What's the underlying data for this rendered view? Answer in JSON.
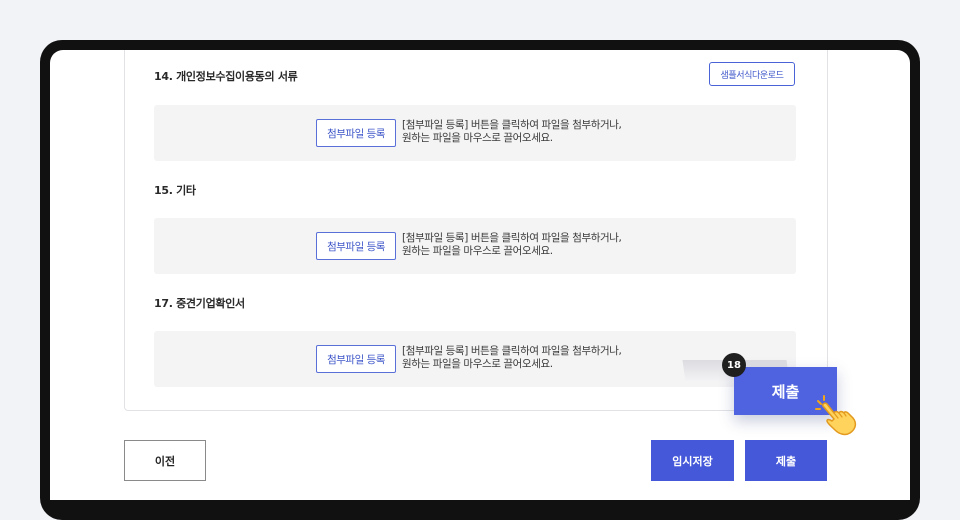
{
  "sections": [
    {
      "title": "14. 개인정보수집이용동의 서류",
      "sample_button": "샘플서식다운로드",
      "attach_button": "첨부파일 등록",
      "instruction_line1": "[첨부파일 등록] 버튼을 클릭하여 파일을 첨부하거나,",
      "instruction_line2": "원하는 파일을 마우스로 끌어오세요."
    },
    {
      "title": "15. 기타",
      "attach_button": "첨부파일 등록",
      "instruction_line1": "[첨부파일 등록] 버튼을 클릭하여 파일을 첨부하거나,",
      "instruction_line2": "원하는 파일을 마우스로 끌어오세요."
    },
    {
      "title": "17. 중견기업확인서",
      "attach_button": "첨부파일 등록",
      "instruction_line1": "[첨부파일 등록] 버튼을 클릭하여 파일을 첨부하거나,",
      "instruction_line2": "원하는 파일을 마우스로 끌어오세요."
    }
  ],
  "footer": {
    "prev_label": "이전",
    "temp_save_label": "임시저장",
    "submit_label": "제출"
  },
  "highlight": {
    "step_number": "18",
    "zoom_label": "제출"
  },
  "colors": {
    "accent": "#4558d9",
    "device_frame": "#111111",
    "background": "#f2f3f7",
    "drop_zone": "#f4f4f5"
  },
  "icons": {
    "pointer": "pointing-hand-icon"
  }
}
